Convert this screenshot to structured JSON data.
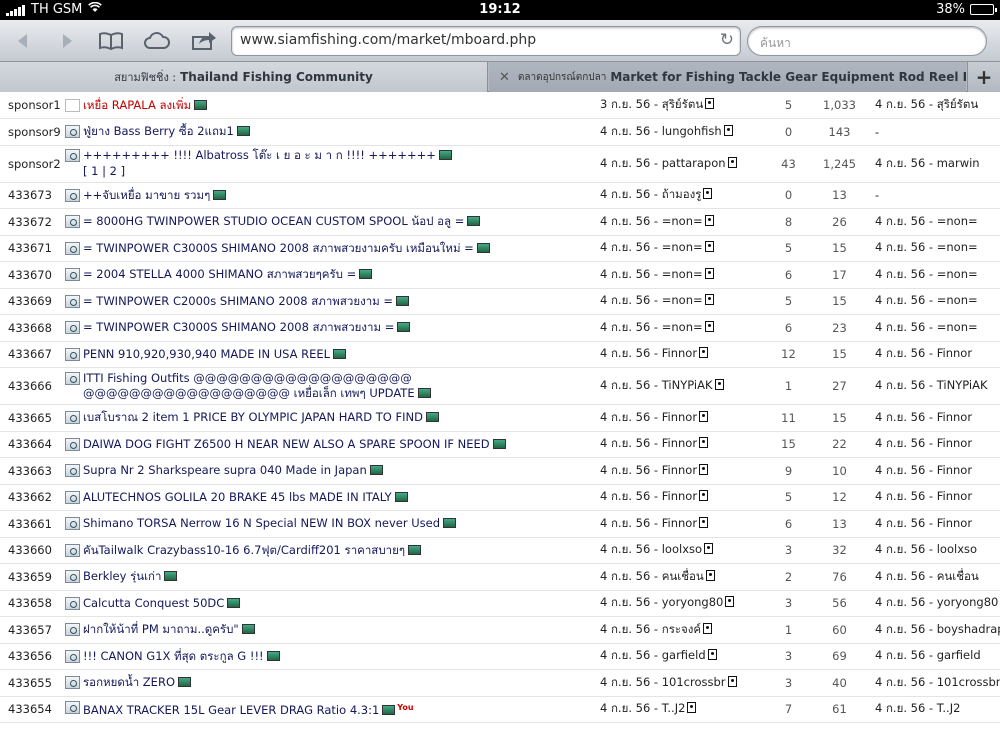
{
  "status_bar": {
    "carrier": "TH GSM",
    "time": "19:12",
    "battery": "38%",
    "battery_level": 0.38
  },
  "toolbar": {
    "url": "www.siamfishing.com/market/mboard.php",
    "search_placeholder": "ค้นหา"
  },
  "tabs": [
    {
      "sub": "สยามฟิชชิ่ง :",
      "title": "Thailand Fishing Community"
    },
    {
      "sub": "ตลาดอุปกรณ์ตกปลา",
      "title": "Market for Fishing Tackle Gear Equipment Rod Reel Lu..."
    }
  ],
  "board": {
    "rows": [
      {
        "id": "sponsor1",
        "title": "เหยื่อ RAPALA ลงเพิ่ม",
        "title_red": true,
        "posted": "3 ก.ย. 56 - สุริย์รัตน",
        "replies": "5",
        "views": "1,033",
        "last": "4 ก.ย. 56 - สุริย์รัตน"
      },
      {
        "id": "sponsor9",
        "title": "ฟู่ยาง Bass Berry ซื้อ 2แถม1",
        "posted": "4 ก.ย. 56 - lungohfish",
        "replies": "0",
        "views": "143",
        "last": "-"
      },
      {
        "id": "sponsor2",
        "title": "+++++++++ !!!! Albatross โต๊ะ เ ย อ ะ ม า ก !!!! +++++++",
        "pager": [
          "1",
          "2"
        ],
        "posted": "4 ก.ย. 56 - pattarapon",
        "replies": "43",
        "views": "1,245",
        "last": "4 ก.ย. 56 - marwin"
      },
      {
        "id": "433673",
        "title": "++จับเหยื่อ มาขาย รวมๆ",
        "posted": "4 ก.ย. 56 - ถ้ามองรู",
        "replies": "0",
        "views": "13",
        "last": "-"
      },
      {
        "id": "433672",
        "title": "= 8000HG TWINPOWER STUDIO OCEAN CUSTOM SPOOL น้อป อลู =",
        "posted": "4 ก.ย. 56 - =non=",
        "replies": "8",
        "views": "26",
        "last": "4 ก.ย. 56 - =non="
      },
      {
        "id": "433671",
        "title": "= TWINPOWER C3000S SHIMANO 2008 สภาพสวยงามครับ เหมือนใหม่ =",
        "posted": "4 ก.ย. 56 - =non=",
        "replies": "5",
        "views": "15",
        "last": "4 ก.ย. 56 - =non="
      },
      {
        "id": "433670",
        "title": "= 2004 STELLA 4000 SHIMANO สภาพสวยๆครับ =",
        "posted": "4 ก.ย. 56 - =non=",
        "replies": "6",
        "views": "17",
        "last": "4 ก.ย. 56 - =non="
      },
      {
        "id": "433669",
        "title": "= TWINPOWER C2000s SHIMANO 2008 สภาพสวยงาม =",
        "posted": "4 ก.ย. 56 - =non=",
        "replies": "5",
        "views": "15",
        "last": "4 ก.ย. 56 - =non="
      },
      {
        "id": "433668",
        "title": "= TWINPOWER C3000S SHIMANO 2008 สภาพสวยงาม =",
        "posted": "4 ก.ย. 56 - =non=",
        "replies": "6",
        "views": "23",
        "last": "4 ก.ย. 56 - =non="
      },
      {
        "id": "433667",
        "title": "PENN 910,920,930,940 MADE IN USA REEL",
        "posted": "4 ก.ย. 56 - Finnor",
        "replies": "12",
        "views": "15",
        "last": "4 ก.ย. 56 - Finnor"
      },
      {
        "id": "433666",
        "title": "ITTI Fishing Outfits @@@@@@@@@@@@@@@@@@@ @@@@@@@@@@@@@@@@@@ เหยื่อเล็ก เทพๆ UPDATE",
        "tall": true,
        "posted": "4 ก.ย. 56 - TiNYPiAK",
        "replies": "1",
        "views": "27",
        "last": "4 ก.ย. 56 - TiNYPiAK"
      },
      {
        "id": "433665",
        "title": "เบสโบราณ 2 item 1 PRICE BY OLYMPIC JAPAN HARD TO FIND",
        "posted": "4 ก.ย. 56 - Finnor",
        "replies": "11",
        "views": "15",
        "last": "4 ก.ย. 56 - Finnor"
      },
      {
        "id": "433664",
        "title": "DAIWA DOG FIGHT Z6500 H NEAR NEW ALSO A SPARE SPOON IF NEED",
        "posted": "4 ก.ย. 56 - Finnor",
        "replies": "15",
        "views": "22",
        "last": "4 ก.ย. 56 - Finnor"
      },
      {
        "id": "433663",
        "title": "Supra Nr 2 Sharkspeare supra 040 Made in Japan",
        "posted": "4 ก.ย. 56 - Finnor",
        "replies": "9",
        "views": "10",
        "last": "4 ก.ย. 56 - Finnor"
      },
      {
        "id": "433662",
        "title": "ALUTECHNOS GOLILA 20 BRAKE 45 lbs MADE IN ITALY",
        "posted": "4 ก.ย. 56 - Finnor",
        "replies": "5",
        "views": "12",
        "last": "4 ก.ย. 56 - Finnor"
      },
      {
        "id": "433661",
        "title": "Shimano TORSA Nerrow 16 N Special NEW IN BOX never Used",
        "posted": "4 ก.ย. 56 - Finnor",
        "replies": "6",
        "views": "13",
        "last": "4 ก.ย. 56 - Finnor"
      },
      {
        "id": "433660",
        "title": "คันTailwalk Crazybass10-16 6.7ฟุต/Cardiff201 ราคาสบายๆ",
        "posted": "4 ก.ย. 56 - loolxso",
        "replies": "3",
        "views": "32",
        "last": "4 ก.ย. 56 - loolxso"
      },
      {
        "id": "433659",
        "title": "Berkley รุ่นเก่า",
        "posted": "4 ก.ย. 56 - คนเชื่อน",
        "replies": "2",
        "views": "76",
        "last": "4 ก.ย. 56 - คนเชื่อน"
      },
      {
        "id": "433658",
        "title": "Calcutta Conquest 50DC",
        "posted": "4 ก.ย. 56 - yoryong80",
        "replies": "3",
        "views": "56",
        "last": "4 ก.ย. 56 - yoryong80"
      },
      {
        "id": "433657",
        "title": "ฝากให้น้าที่ PM มาถาม..ดูครับ\"",
        "posted": "4 ก.ย. 56 - กระจงค์",
        "replies": "1",
        "views": "60",
        "last": "4 ก.ย. 56 - boyshadrap"
      },
      {
        "id": "433656",
        "title": "!!! CANON G1X ที่สุด ตระกูล G !!!",
        "posted": "4 ก.ย. 56 - garfield",
        "replies": "3",
        "views": "69",
        "last": "4 ก.ย. 56 - garfield"
      },
      {
        "id": "433655",
        "title": "รอกหยดน้ำ ZERO",
        "posted": "4 ก.ย. 56 - 101crossbr",
        "replies": "3",
        "views": "40",
        "last": "4 ก.ย. 56 - 101crossbr"
      },
      {
        "id": "433654",
        "title": "BANAX TRACKER 15L Gear LEVER DRAG Ratio 4.3:1",
        "youtube": "You",
        "posted": "4 ก.ย. 56 - T..J2",
        "replies": "7",
        "views": "61",
        "last": "4 ก.ย. 56 - T..J2"
      }
    ]
  }
}
